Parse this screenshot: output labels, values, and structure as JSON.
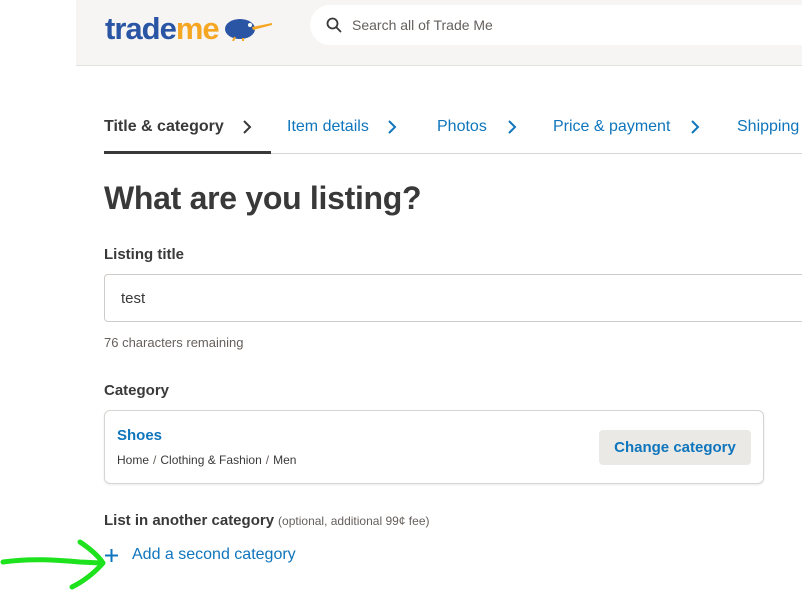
{
  "header": {
    "logo_trade": "trade",
    "logo_me": "me",
    "search_placeholder": "Search all of Trade Me"
  },
  "steps": [
    {
      "label": "Title & category",
      "active": true
    },
    {
      "label": "Item details",
      "active": false
    },
    {
      "label": "Photos",
      "active": false
    },
    {
      "label": "Price & payment",
      "active": false
    },
    {
      "label": "Shipping",
      "active": false
    }
  ],
  "page_title": "What are you listing?",
  "listing_title": {
    "label": "Listing title",
    "value": "test",
    "helper": "76 characters remaining"
  },
  "category": {
    "label": "Category",
    "name": "Shoes",
    "breadcrumb": [
      "Home",
      "Clothing & Fashion",
      "Men"
    ],
    "change_button": "Change category"
  },
  "another_category": {
    "label": "List in another category",
    "note": "(optional, additional 99¢ fee)",
    "add_link": "Add a second category"
  },
  "colors": {
    "link_blue": "#0f75bc",
    "text": "#393939",
    "logo_blue": "#2955a4",
    "logo_orange": "#f5a623",
    "annotation_green": "#1de21d"
  }
}
